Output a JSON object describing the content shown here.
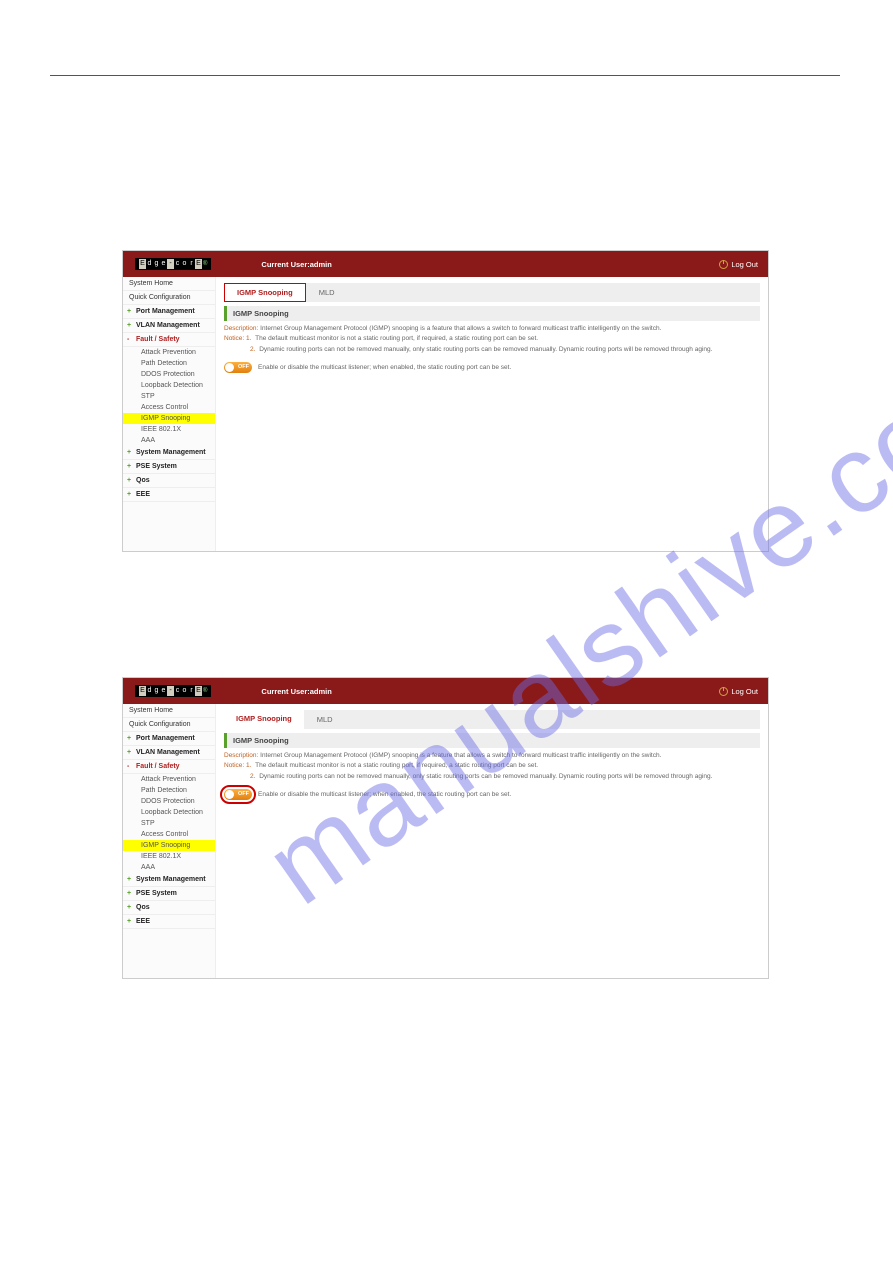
{
  "watermark": "manualshive.com",
  "header": {
    "logo_letters": [
      "E",
      "d",
      "g",
      "e",
      "-",
      "c",
      "o",
      "r",
      "E"
    ],
    "user_text": "Current User:admin",
    "logout": "Log Out"
  },
  "sidebar": {
    "items": [
      {
        "label": "System Home",
        "children": [],
        "expander": ""
      },
      {
        "label": "Quick Configuration",
        "children": [],
        "expander": ""
      },
      {
        "label": "Port Management",
        "children": [],
        "expander": "+"
      },
      {
        "label": "VLAN Management",
        "children": [],
        "expander": "+"
      },
      {
        "label": "Fault / Safety",
        "expander": "-",
        "active": true,
        "children": [
          {
            "label": "Attack Prevention"
          },
          {
            "label": "Path Detection"
          },
          {
            "label": "DDOS Protection"
          },
          {
            "label": "Loopback Detection"
          },
          {
            "label": "STP"
          },
          {
            "label": "Access Control"
          },
          {
            "label": "IGMP Snooping",
            "highlight": true
          },
          {
            "label": "IEEE 802.1X"
          },
          {
            "label": "AAA"
          }
        ]
      },
      {
        "label": "System Management",
        "children": [],
        "expander": "+"
      },
      {
        "label": "PSE System",
        "children": [],
        "expander": "+"
      },
      {
        "label": "Qos",
        "children": [],
        "expander": "+"
      },
      {
        "label": "EEE",
        "children": [],
        "expander": "+"
      }
    ]
  },
  "tabs": {
    "items": [
      {
        "label": "IGMP Snooping",
        "active": true
      },
      {
        "label": "MLD",
        "active": false
      }
    ]
  },
  "panel": {
    "title": "IGMP Snooping",
    "desc_label": "Description:",
    "desc_text": "Internet Group Management Protocol (IGMP) snooping is a feature that allows a switch to forward multicast traffic intelligently on the switch.",
    "notice_label": "Notice:",
    "notice_1": "The default multicast monitor is not a static routing port, if required, a static routing port can be set.",
    "notice_2": "Dynamic routing ports can not be removed manually, only static routing ports can be removed manually. Dynamic routing ports will be removed through aging.",
    "toggle_label": "OFF",
    "toggle_text": "Enable or disable the multicast listener; when enabled, the static routing port can be set."
  },
  "screenshot2": {
    "tab_redbox": true,
    "toggle_redbox": true
  }
}
